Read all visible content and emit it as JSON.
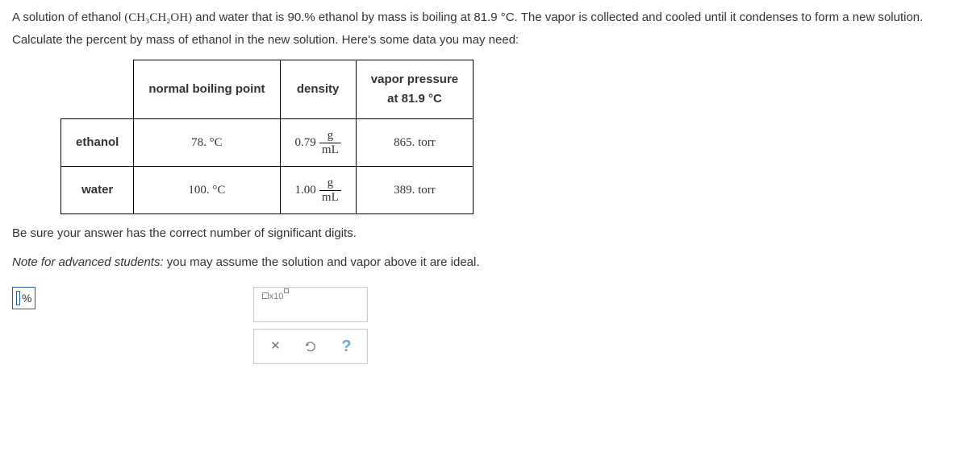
{
  "problem": {
    "line1_pre": "A solution of ethanol ",
    "line1_formula": "(CH₃CH₂OH)",
    "line1_post": " and water that is 90.% ethanol by mass is boiling at 81.9 °C. The vapor is collected and cooled until it condenses to form a new solution.",
    "line2": "Calculate the percent by mass of ethanol in the new solution. Here's some data you may need:"
  },
  "table": {
    "headers": {
      "col1": "normal boiling point",
      "col2": "density",
      "col3_a": "vapor pressure",
      "col3_b": "at 81.9 °C"
    },
    "rows": [
      {
        "label": "ethanol",
        "bp": "78. °C",
        "density_num": "0.79",
        "density_unit_top": "g",
        "density_unit_bot": "mL",
        "vp": "865. torr"
      },
      {
        "label": "water",
        "bp": "100. °C",
        "density_num": "1.00",
        "density_unit_top": "g",
        "density_unit_bot": "mL",
        "vp": "389. torr"
      }
    ]
  },
  "notes": {
    "sigfig": "Be sure your answer has the correct number of significant digits.",
    "adv_pre": "Note for advanced students:",
    "adv_post": " you may assume the solution and vapor above it are ideal."
  },
  "answer": {
    "unit": "%"
  },
  "toolbox": {
    "sci_base": "x10",
    "help": "?"
  }
}
